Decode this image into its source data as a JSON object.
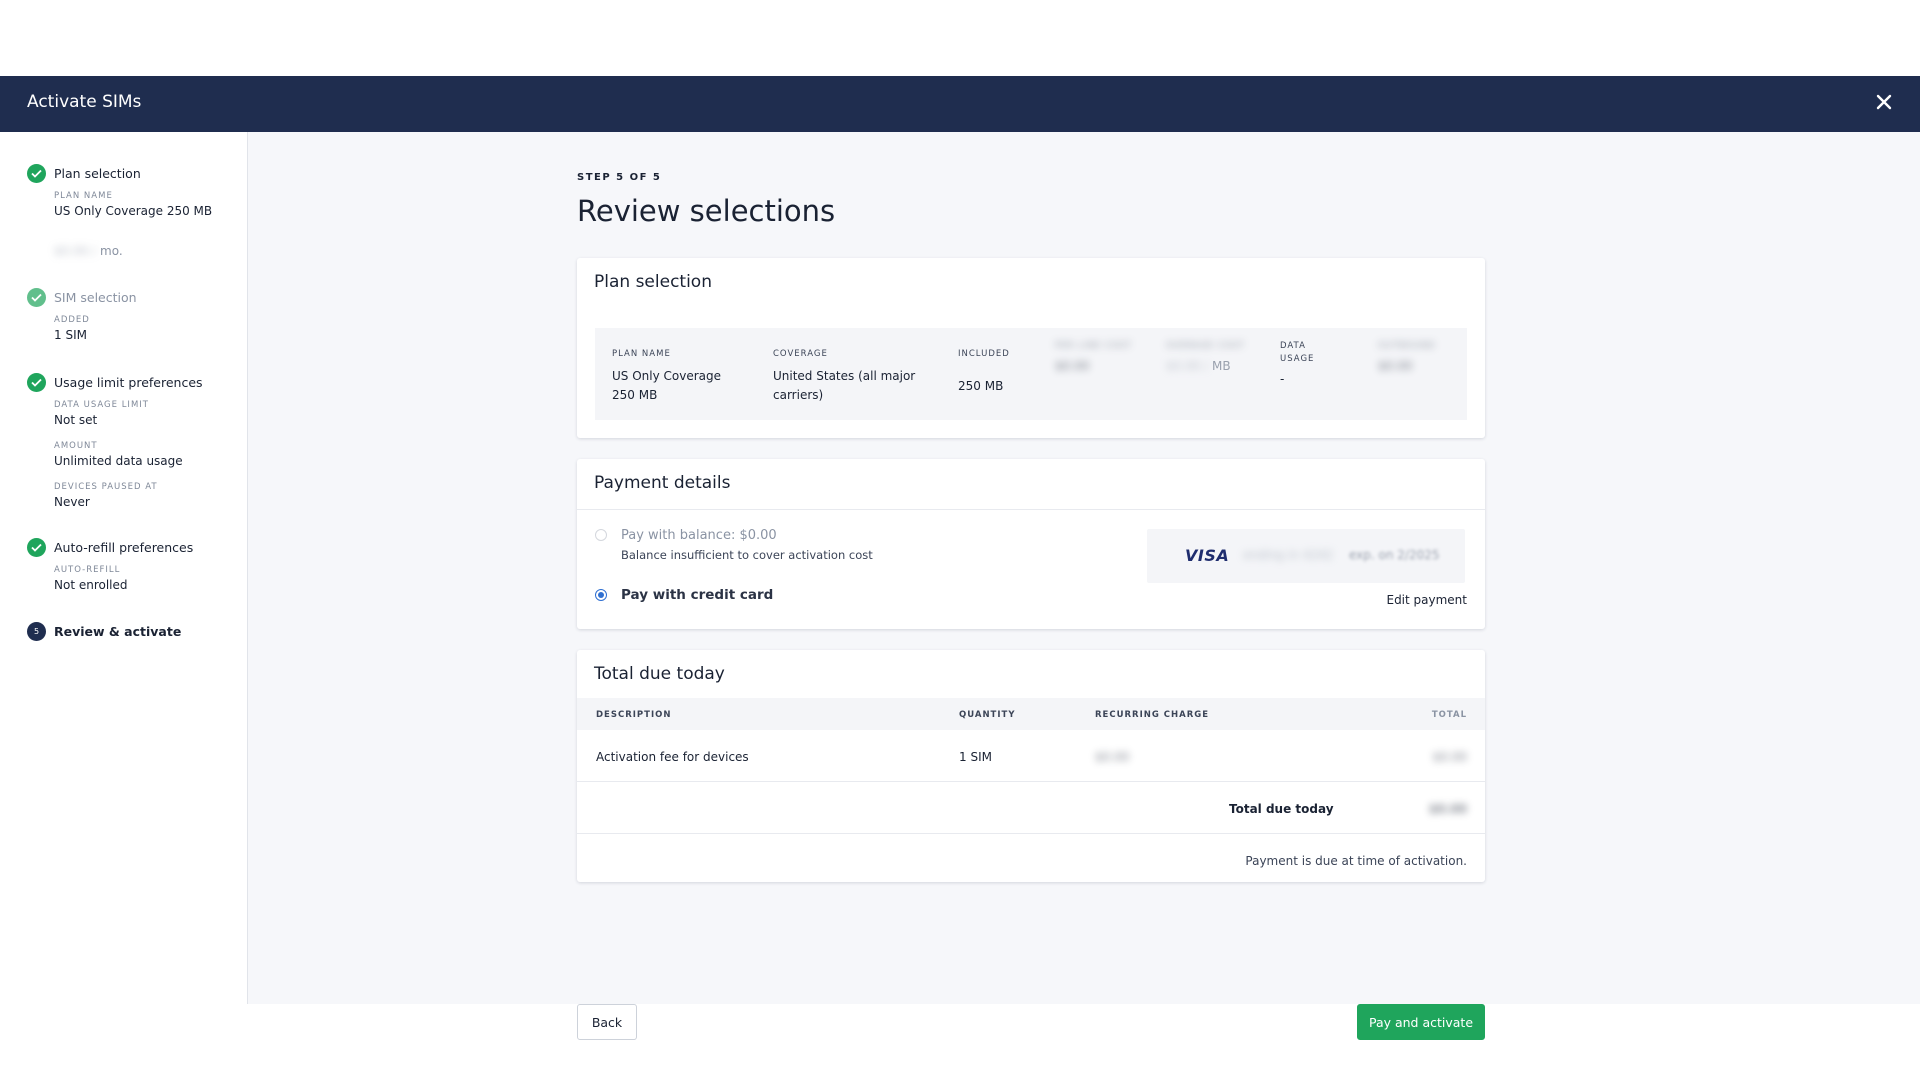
{
  "modal": {
    "title": "Activate SIMs",
    "close_icon": "close-icon"
  },
  "sidebar": {
    "steps": [
      {
        "name": "Plan selection",
        "fields": [
          {
            "label": "PLAN NAME",
            "value": "US Only Coverage 250 MB"
          },
          {
            "label": "",
            "value": "mo."
          }
        ]
      },
      {
        "name": "SIM selection",
        "fields": [
          {
            "label": "ADDED",
            "value": "1 SIM"
          }
        ]
      },
      {
        "name": "Usage limit preferences",
        "fields": [
          {
            "label": "DATA USAGE LIMIT",
            "value": "Not set"
          },
          {
            "label": "AMOUNT",
            "value": "Unlimited data usage"
          },
          {
            "label": "DEVICES PAUSED AT",
            "value": "Never"
          }
        ]
      },
      {
        "name": "Auto-refill preferences",
        "fields": [
          {
            "label": "AUTO-REFILL",
            "value": "Not enrolled"
          }
        ]
      },
      {
        "name": "Review & activate",
        "number": "5"
      }
    ]
  },
  "main": {
    "kicker": "STEP 5 OF 5",
    "heading": "Review selections",
    "plan_card": {
      "title": "Plan selection",
      "columns": [
        {
          "header": "PLAN NAME",
          "value": "US Only Coverage 250 MB"
        },
        {
          "header": "COVERAGE",
          "value": "United States (all major carriers)"
        },
        {
          "header": "INCLUDED",
          "value": "250 MB"
        },
        {
          "header": "PER LINE COST",
          "value": ""
        },
        {
          "header": "OVERAGE COST",
          "value": "MB"
        },
        {
          "header": "DATA USAGE",
          "value": "-"
        },
        {
          "header": "OUTBOUND",
          "value": ""
        }
      ]
    },
    "payment_card": {
      "title": "Payment details",
      "balance_option": "Pay with balance: $0.00",
      "balance_note": "Balance insufficient to cover activation cost",
      "credit_option": "Pay with credit card",
      "card_brand": "VISA",
      "card_ending": "ending in 4242",
      "card_exp": "exp. on 2/2025",
      "edit_link": "Edit payment"
    },
    "total_card": {
      "title": "Total due today",
      "headers": {
        "description": "DESCRIPTION",
        "quantity": "QUANTITY",
        "recurring": "RECURRING CHARGE",
        "total": "TOTAL"
      },
      "rows": [
        {
          "description": "Activation fee for devices",
          "quantity": "1 SIM"
        }
      ],
      "total_label": "Total due today",
      "note": "Payment is due at time of activation."
    },
    "buttons": {
      "back": "Back",
      "pay": "Pay and activate"
    }
  },
  "colors": {
    "header": "#1f2d4f",
    "success": "#1fa55c",
    "link": "#3a5fd0",
    "background": "#f6f7fa"
  }
}
